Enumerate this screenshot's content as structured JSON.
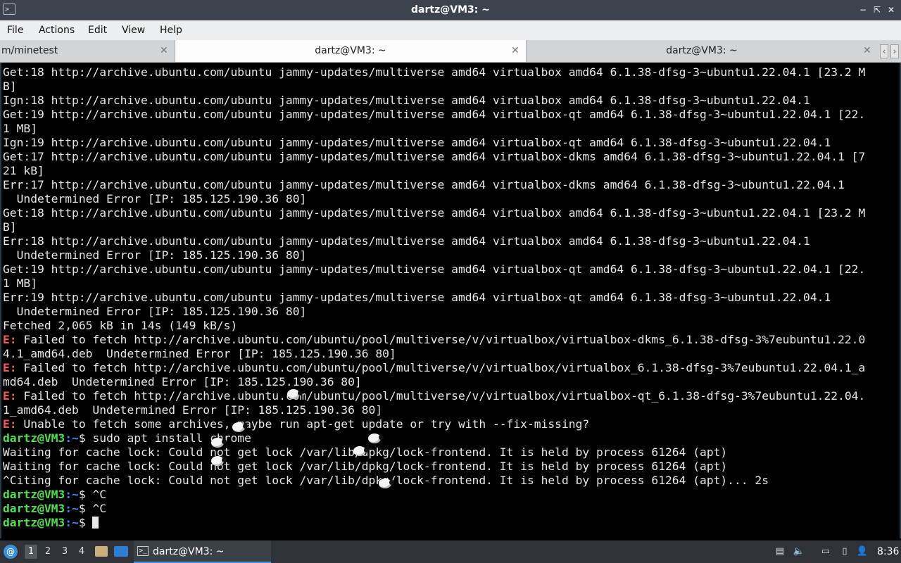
{
  "window": {
    "title": "dartz@VM3: ~",
    "app_icon_text": ">_",
    "controls": {
      "minimize": "−",
      "maximize": "⇱",
      "close": "✕"
    }
  },
  "menu": [
    "File",
    "Actions",
    "Edit",
    "View",
    "Help"
  ],
  "tabs": [
    {
      "label": "m/minetest",
      "close": "✕"
    },
    {
      "label": "dartz@VM3: ~",
      "close": "✕"
    },
    {
      "label": "dartz@VM3: ~",
      "close": "✕"
    }
  ],
  "tab_scroll": {
    "left": "‹",
    "right": "›"
  },
  "terminal": {
    "lines": [
      {
        "text": "Get:18 http://archive.ubuntu.com/ubuntu jammy-updates/multiverse amd64 virtualbox amd64 6.1.38-dfsg-3~ubuntu1.22.04.1 [23.2 M"
      },
      {
        "text": "B]"
      },
      {
        "text": "Ign:18 http://archive.ubuntu.com/ubuntu jammy-updates/multiverse amd64 virtualbox amd64 6.1.38-dfsg-3~ubuntu1.22.04.1"
      },
      {
        "text": "Get:19 http://archive.ubuntu.com/ubuntu jammy-updates/multiverse amd64 virtualbox-qt amd64 6.1.38-dfsg-3~ubuntu1.22.04.1 [22."
      },
      {
        "text": "1 MB]"
      },
      {
        "text": "Ign:19 http://archive.ubuntu.com/ubuntu jammy-updates/multiverse amd64 virtualbox-qt amd64 6.1.38-dfsg-3~ubuntu1.22.04.1"
      },
      {
        "text": "Get:17 http://archive.ubuntu.com/ubuntu jammy-updates/multiverse amd64 virtualbox-dkms amd64 6.1.38-dfsg-3~ubuntu1.22.04.1 [7"
      },
      {
        "text": "21 kB]"
      },
      {
        "text": "Err:17 http://archive.ubuntu.com/ubuntu jammy-updates/multiverse amd64 virtualbox-dkms amd64 6.1.38-dfsg-3~ubuntu1.22.04.1"
      },
      {
        "text": "  Undetermined Error [IP: 185.125.190.36 80]"
      },
      {
        "text": "Get:18 http://archive.ubuntu.com/ubuntu jammy-updates/multiverse amd64 virtualbox amd64 6.1.38-dfsg-3~ubuntu1.22.04.1 [23.2 M"
      },
      {
        "text": "B]"
      },
      {
        "text": "Err:18 http://archive.ubuntu.com/ubuntu jammy-updates/multiverse amd64 virtualbox amd64 6.1.38-dfsg-3~ubuntu1.22.04.1"
      },
      {
        "text": "  Undetermined Error [IP: 185.125.190.36 80]"
      },
      {
        "text": "Get:19 http://archive.ubuntu.com/ubuntu jammy-updates/multiverse amd64 virtualbox-qt amd64 6.1.38-dfsg-3~ubuntu1.22.04.1 [22."
      },
      {
        "text": "1 MB]"
      },
      {
        "text": "Err:19 http://archive.ubuntu.com/ubuntu jammy-updates/multiverse amd64 virtualbox-qt amd64 6.1.38-dfsg-3~ubuntu1.22.04.1"
      },
      {
        "text": "  Undetermined Error [IP: 185.125.190.36 80]"
      },
      {
        "text": "Fetched 2,065 kB in 14s (149 kB/s)"
      },
      {
        "prefix": "E:",
        "text": " Failed to fetch http://archive.ubuntu.com/ubuntu/pool/multiverse/v/virtualbox/virtualbox-dkms_6.1.38-dfsg-3%7eubuntu1.22.0"
      },
      {
        "text": "4.1_amd64.deb  Undetermined Error [IP: 185.125.190.36 80]"
      },
      {
        "prefix": "E:",
        "text": " Failed to fetch http://archive.ubuntu.com/ubuntu/pool/multiverse/v/virtualbox/virtualbox_6.1.38-dfsg-3%7eubuntu1.22.04.1_a"
      },
      {
        "text": "md64.deb  Undetermined Error [IP: 185.125.190.36 80]"
      },
      {
        "prefix": "E:",
        "text": " Failed to fetch http://archive.ubuntu.com/ubuntu/pool/multiverse/v/virtualbox/virtualbox-qt_6.1.38-dfsg-3%7eubuntu1.22.04."
      },
      {
        "text": "1_amd64.deb  Undetermined Error [IP: 185.125.190.36 80]"
      },
      {
        "prefix": "E:",
        "text": " Unable to fetch some archives, maybe run apt-get update or try with --fix-missing?"
      },
      {
        "user": "dartz@VM3",
        "path": "~",
        "text": "$ sudo apt install chrome"
      },
      {
        "text": "Waiting for cache lock: Could not get lock /var/lib/dpkg/lock-frontend. It is held by process 61264 (apt)"
      },
      {
        "text": "Waiting for cache lock: Could not get lock /var/lib/dpkg/lock-frontend. It is held by process 61264 (apt)"
      },
      {
        "text": "^Citing for cache lock: Could not get lock /var/lib/dpkg/lock-frontend. It is held by process 61264 (apt)... 2s"
      },
      {
        "user": "dartz@VM3",
        "path": "~",
        "text": "$ ^C"
      },
      {
        "user": "dartz@VM3",
        "path": "~",
        "text": "$ ^C"
      },
      {
        "user": "dartz@VM3",
        "path": "~",
        "text": "$ ",
        "cursor": true
      }
    ],
    "colors": {
      "error": "#f15a5a",
      "prompt_user": "#4fe04a",
      "prompt_path": "#4d8cf5",
      "text": "#e6e6e6"
    }
  },
  "taskbar": {
    "start_icon": "swirl-icon",
    "workspaces": [
      "1",
      "2",
      "3",
      "4"
    ],
    "active_workspace": "1",
    "task_label": "dartz@VM3: ~",
    "task_icon": ">_",
    "tray_icons": [
      "▤",
      "🔈",
      "▭",
      "▯",
      "👤"
    ],
    "clock": "8:36"
  }
}
